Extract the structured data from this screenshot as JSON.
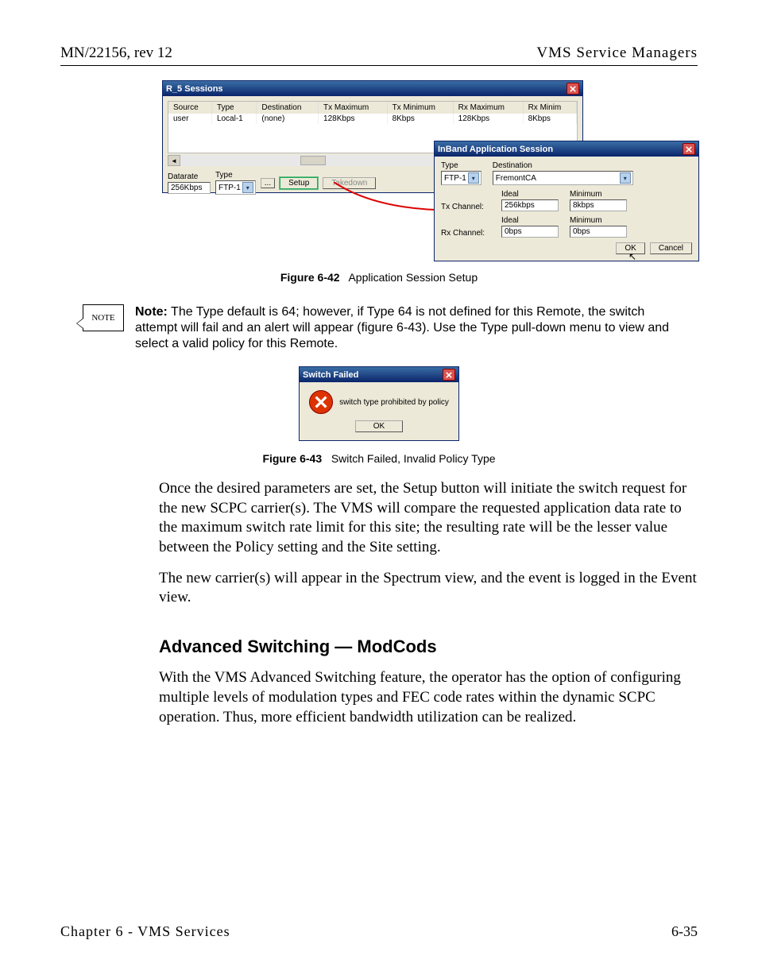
{
  "header": {
    "left": "MN/22156, rev 12",
    "right": "VMS Service Managers"
  },
  "fig1": {
    "win_title": "R_5 Sessions",
    "columns": [
      "Source",
      "Type",
      "Destination",
      "Tx Maximum",
      "Tx Minimum",
      "Rx Maximum",
      "Rx Minim"
    ],
    "row": [
      "user",
      "Local-1",
      "(none)",
      "128Kbps",
      "8Kbps",
      "128Kbps",
      "8Kbps"
    ],
    "datarate_label": "Datarate",
    "datarate_value": "256Kbps",
    "type_label": "Type",
    "type_value": "FTP-1",
    "more_btn": "...",
    "setup_btn": "Setup",
    "takedown_btn": "Takedown",
    "dlg_title": "InBand Application Session",
    "dlg_type_label": "Type",
    "dlg_type_value": "FTP-1",
    "dlg_dest_label": "Destination",
    "dlg_dest_value": "FremontCA",
    "tx_label": "Tx Channel:",
    "rx_label": "Rx Channel:",
    "ideal_label": "Ideal",
    "minimum_label": "Minimum",
    "tx_ideal": "256kbps",
    "tx_min": "8kbps",
    "rx_ideal": "0bps",
    "rx_min": "0bps",
    "ok": "OK",
    "cancel": "Cancel",
    "caption_bold": "Figure 6-42",
    "caption_rest": "Application Session Setup"
  },
  "note": {
    "box": "NOTE",
    "label": "Note:",
    "text": "The Type default is 64; however, if Type 64 is not defined for this Remote, the switch attempt will fail and an alert will appear (figure 6-43). Use the Type pull-down menu to view and select a valid policy for this Remote."
  },
  "fig2": {
    "title": "Switch Failed",
    "msg": "switch type prohibited by policy",
    "ok": "OK",
    "caption_bold": "Figure 6-43",
    "caption_rest": "Switch Failed, Invalid Policy Type"
  },
  "para1": "Once the desired parameters are set, the Setup button will initiate the switch request for the new SCPC carrier(s). The VMS will compare the requested application data rate to the maximum switch rate limit for this site; the resulting rate will be the lesser value between the Policy setting and the Site setting.",
  "para2": "The new carrier(s) will appear in the Spectrum view, and the event is logged in the Event view.",
  "section_title": "Advanced Switching — ModCods",
  "para3": "With the VMS Advanced Switching feature, the operator has the option of configuring multiple levels of modulation types and FEC code rates within the dynamic SCPC operation. Thus, more efficient bandwidth utilization can be realized.",
  "footer": {
    "left": "Chapter 6 - VMS Services",
    "right": "6-35"
  }
}
